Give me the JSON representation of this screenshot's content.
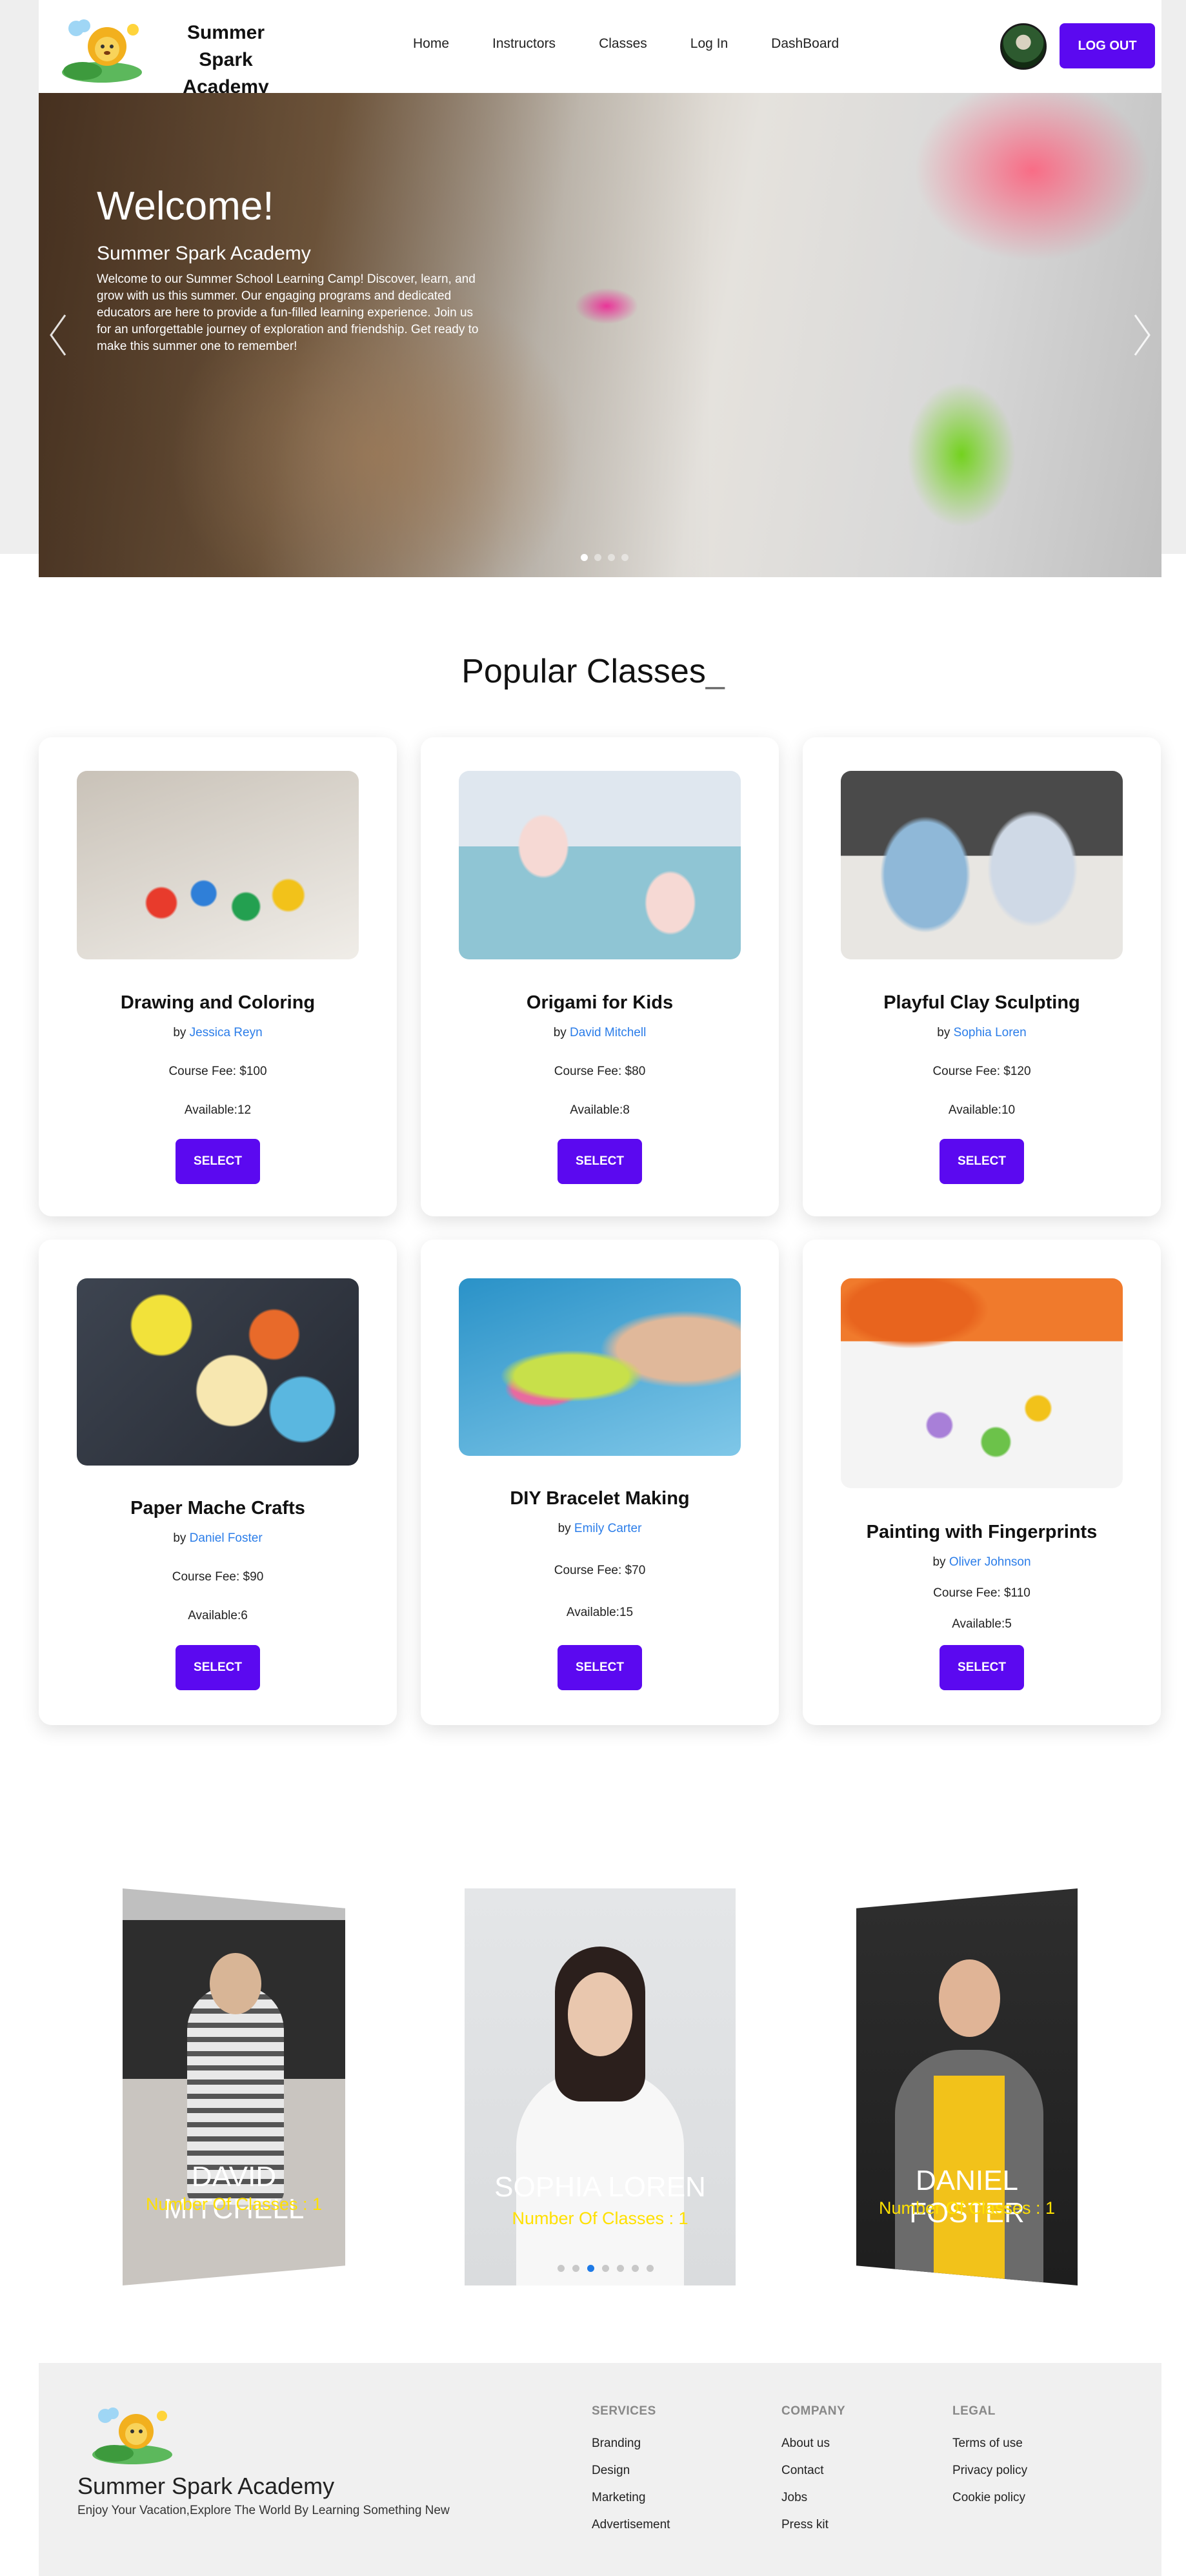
{
  "header": {
    "brand_line1": "Summer Spark",
    "brand_line2": "Academy",
    "nav": [
      "Home",
      "Instructors",
      "Classes",
      "Log In",
      "DashBoard"
    ],
    "logout_label": "LOG OUT"
  },
  "hero": {
    "title": "Welcome!",
    "subtitle": "Summer Spark Academy",
    "text": "Welcome to our Summer School Learning Camp! Discover, learn, and grow with us this summer. Our engaging programs and dedicated educators are here to provide a fun-filled learning experience. Join us for an unforgettable journey of exploration and friendship. Get ready to make this summer one to remember!",
    "slides": 4,
    "active_slide": 1
  },
  "popular": {
    "title": "Popular Classes",
    "cursor": "_",
    "select_label": "SELECT",
    "by_label": "by",
    "classes": [
      {
        "title": "Drawing and Coloring",
        "instructor": "Jessica Reyn",
        "fee": "Course Fee: $100",
        "available": "Available:12"
      },
      {
        "title": "Origami for Kids",
        "instructor": "David Mitchell",
        "fee": "Course Fee: $80",
        "available": "Available:8"
      },
      {
        "title": "Playful Clay Sculpting",
        "instructor": "Sophia Loren",
        "fee": "Course Fee: $120",
        "available": "Available:10"
      },
      {
        "title": "Paper Mache Crafts",
        "instructor": "Daniel Foster",
        "fee": "Course Fee: $90",
        "available": "Available:6"
      },
      {
        "title": "DIY Bracelet Making",
        "instructor": "Emily Carter",
        "fee": "Course Fee: $70",
        "available": "Available:15"
      },
      {
        "title": "Painting with Fingerprints",
        "instructor": "Oliver Johnson",
        "fee": "Course Fee: $110",
        "available": "Available:5"
      }
    ]
  },
  "instructors": {
    "items": [
      {
        "name": "David Mitchell",
        "count": "Number Of Classes : 1"
      },
      {
        "name": "Sophia Loren",
        "count": "Number Of Classes : 1"
      },
      {
        "name": "Daniel Foster",
        "count": "Number Of Classes : 1"
      }
    ],
    "dots": 7,
    "active_dot": 3
  },
  "footer": {
    "brand": "Summer Spark Academy",
    "tagline": "Enjoy Your Vacation,Explore The World By Learning Something New",
    "services": {
      "title": "SERVICES",
      "links": [
        "Branding",
        "Design",
        "Marketing",
        "Advertisement"
      ]
    },
    "company": {
      "title": "COMPANY",
      "links": [
        "About us",
        "Contact",
        "Jobs",
        "Press kit"
      ]
    },
    "legal": {
      "title": "LEGAL",
      "links": [
        "Terms of use",
        "Privacy policy",
        "Cookie policy"
      ]
    }
  },
  "colors": {
    "accent": "#5b09f0",
    "link": "#2b7de9",
    "highlight": "#ffe000",
    "footer_bg": "#f0f0f0"
  }
}
